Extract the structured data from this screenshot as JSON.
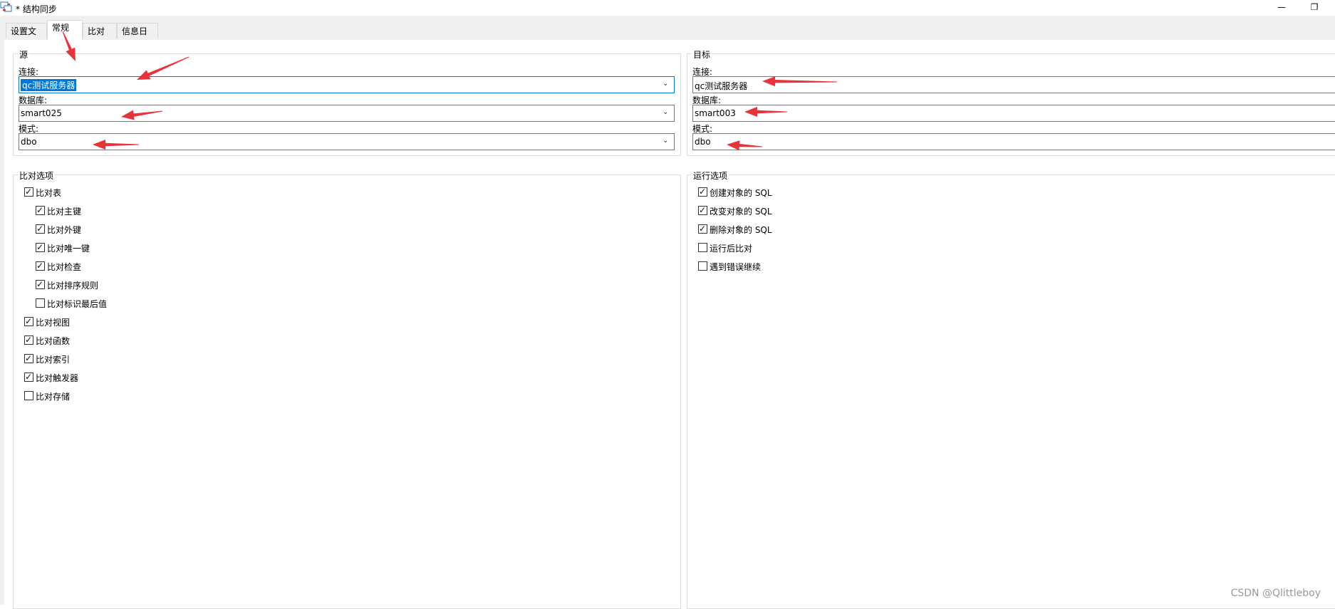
{
  "window": {
    "title": "* 结构同步",
    "minimize": "—",
    "restore": "❐"
  },
  "tabs": [
    {
      "label": "设置文件",
      "active": false
    },
    {
      "label": "常规",
      "active": true
    },
    {
      "label": "比对",
      "active": false
    },
    {
      "label": "信息日志",
      "active": false
    }
  ],
  "source": {
    "title": "源",
    "connection_label": "连接:",
    "connection_value": "qc测试服务器",
    "database_label": "数据库:",
    "database_value": "smart025",
    "schema_label": "模式:",
    "schema_value": "dbo"
  },
  "target": {
    "title": "目标",
    "connection_label": "连接:",
    "connection_value": "qc测试服务器",
    "database_label": "数据库:",
    "database_value": "smart003",
    "schema_label": "模式:",
    "schema_value": "dbo"
  },
  "compare_options": {
    "title": "比对选项",
    "items": [
      {
        "label": "比对表",
        "checked": true,
        "indent": 0
      },
      {
        "label": "比对主键",
        "checked": true,
        "indent": 1
      },
      {
        "label": "比对外键",
        "checked": true,
        "indent": 1
      },
      {
        "label": "比对唯一键",
        "checked": true,
        "indent": 1
      },
      {
        "label": "比对检查",
        "checked": true,
        "indent": 1
      },
      {
        "label": "比对排序规则",
        "checked": true,
        "indent": 1
      },
      {
        "label": "比对标识最后值",
        "checked": false,
        "indent": 1
      },
      {
        "label": "比对视图",
        "checked": true,
        "indent": 0
      },
      {
        "label": "比对函数",
        "checked": true,
        "indent": 0
      },
      {
        "label": "比对索引",
        "checked": true,
        "indent": 0
      },
      {
        "label": "比对触发器",
        "checked": true,
        "indent": 0
      },
      {
        "label": "比对存储",
        "checked": false,
        "indent": 0
      }
    ]
  },
  "run_options": {
    "title": "运行选项",
    "items": [
      {
        "label": "创建对象的 SQL",
        "checked": true
      },
      {
        "label": "改变对象的 SQL",
        "checked": true
      },
      {
        "label": "删除对象的 SQL",
        "checked": true
      },
      {
        "label": "运行后比对",
        "checked": false
      },
      {
        "label": "遇到错误继续",
        "checked": false
      }
    ]
  },
  "watermark": "CSDN @Qlittleboy",
  "annotation_color": "#e8333b"
}
